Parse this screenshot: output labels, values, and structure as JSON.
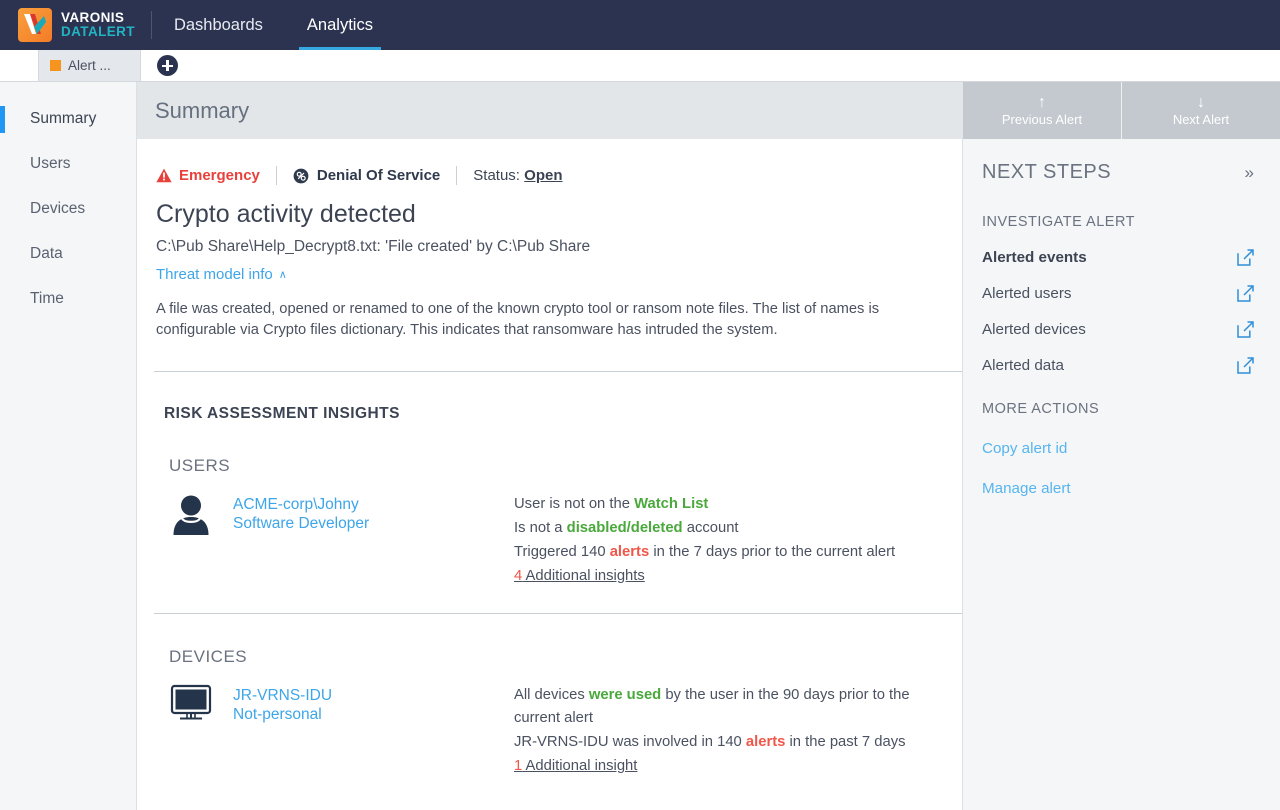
{
  "topbar": {
    "brand_line1": "VARONIS",
    "brand_line2": "DATALERT",
    "nav": [
      {
        "label": "Dashboards",
        "active": false
      },
      {
        "label": "Analytics",
        "active": true
      }
    ]
  },
  "tabstrip": {
    "tab_label": "Alert ...",
    "tab_dot_color": "#f7941e",
    "add_tab_label": "+"
  },
  "sidebar": {
    "items": [
      {
        "label": "Summary",
        "active": true
      },
      {
        "label": "Users",
        "active": false
      },
      {
        "label": "Devices",
        "active": false
      },
      {
        "label": "Data",
        "active": false
      },
      {
        "label": "Time",
        "active": false
      }
    ],
    "active_indicator_color": "#2196f3"
  },
  "summary_bar": {
    "title": "Summary"
  },
  "alert_nav": {
    "previous": {
      "label": "Previous Alert",
      "arrow": "↑"
    },
    "next": {
      "label": "Next Alert",
      "arrow": "↓"
    }
  },
  "alert": {
    "severity": "Emergency",
    "severity_color": "#e8413c",
    "category": "Denial Of Service",
    "status_label": "Status:",
    "status_value": "Open",
    "title": "Crypto activity detected",
    "subtitle": "C:\\Pub Share\\Help_Decrypt8.txt: 'File created' by C:\\Pub Share",
    "threat_model_link": "Threat model info",
    "threat_model_chevron": "∧",
    "threat_description": "A file was created, opened or renamed to one of the known crypto tool or ransom note files. The list of names is configurable via Crypto files dictionary. This indicates that ransomware has intruded the system."
  },
  "risk_assessment": {
    "heading": "RISK ASSESSMENT INSIGHTS",
    "sections": [
      {
        "heading": "USERS",
        "icon": "user-icon",
        "entity_primary": "ACME-corp\\Johny",
        "entity_secondary": "Software Developer",
        "facts": [
          {
            "parts": [
              {
                "t": "User is not on the ",
                "k": "n"
              },
              {
                "t": "Watch List",
                "k": "g"
              }
            ]
          },
          {
            "parts": [
              {
                "t": "Is not a ",
                "k": "n"
              },
              {
                "t": "disabled/deleted",
                "k": "g"
              },
              {
                "t": " account",
                "k": "n"
              }
            ]
          },
          {
            "parts": [
              {
                "t": "Triggered 140 ",
                "k": "n"
              },
              {
                "t": "alerts",
                "k": "r"
              },
              {
                "t": " in the 7 days prior to the current alert",
                "k": "n"
              }
            ]
          }
        ],
        "more_num": "4",
        "more_label": " Additional insights"
      },
      {
        "heading": "DEVICES",
        "icon": "monitor-icon",
        "entity_primary": "JR-VRNS-IDU",
        "entity_secondary": "Not-personal",
        "facts": [
          {
            "parts": [
              {
                "t": "All devices ",
                "k": "n"
              },
              {
                "t": "were used",
                "k": "g"
              },
              {
                "t": " by the user in the 90 days prior to the current alert",
                "k": "n"
              }
            ]
          },
          {
            "parts": [
              {
                "t": "JR-VRNS-IDU was involved in 140 ",
                "k": "n"
              },
              {
                "t": "alerts",
                "k": "r"
              },
              {
                "t": " in the past 7 days",
                "k": "n"
              }
            ]
          }
        ],
        "more_num": "1",
        "more_label": " Additional insight"
      }
    ]
  },
  "next_steps": {
    "title": "NEXT STEPS",
    "collapse_chevron": "»",
    "investigate_heading": "INVESTIGATE ALERT",
    "investigate_items": [
      {
        "label": "Alerted events",
        "current": true
      },
      {
        "label": "Alerted users",
        "current": false
      },
      {
        "label": "Alerted devices",
        "current": false
      },
      {
        "label": "Alerted data",
        "current": false
      }
    ],
    "more_heading": "MORE ACTIONS",
    "more_items": [
      {
        "label": "Copy alert id"
      },
      {
        "label": "Manage alert"
      }
    ]
  },
  "colors": {
    "navy": "#2b3350",
    "accent_blue": "#3da5e8",
    "green": "#4aa83c",
    "red": "#f0564a",
    "orange": "#f7941e"
  }
}
